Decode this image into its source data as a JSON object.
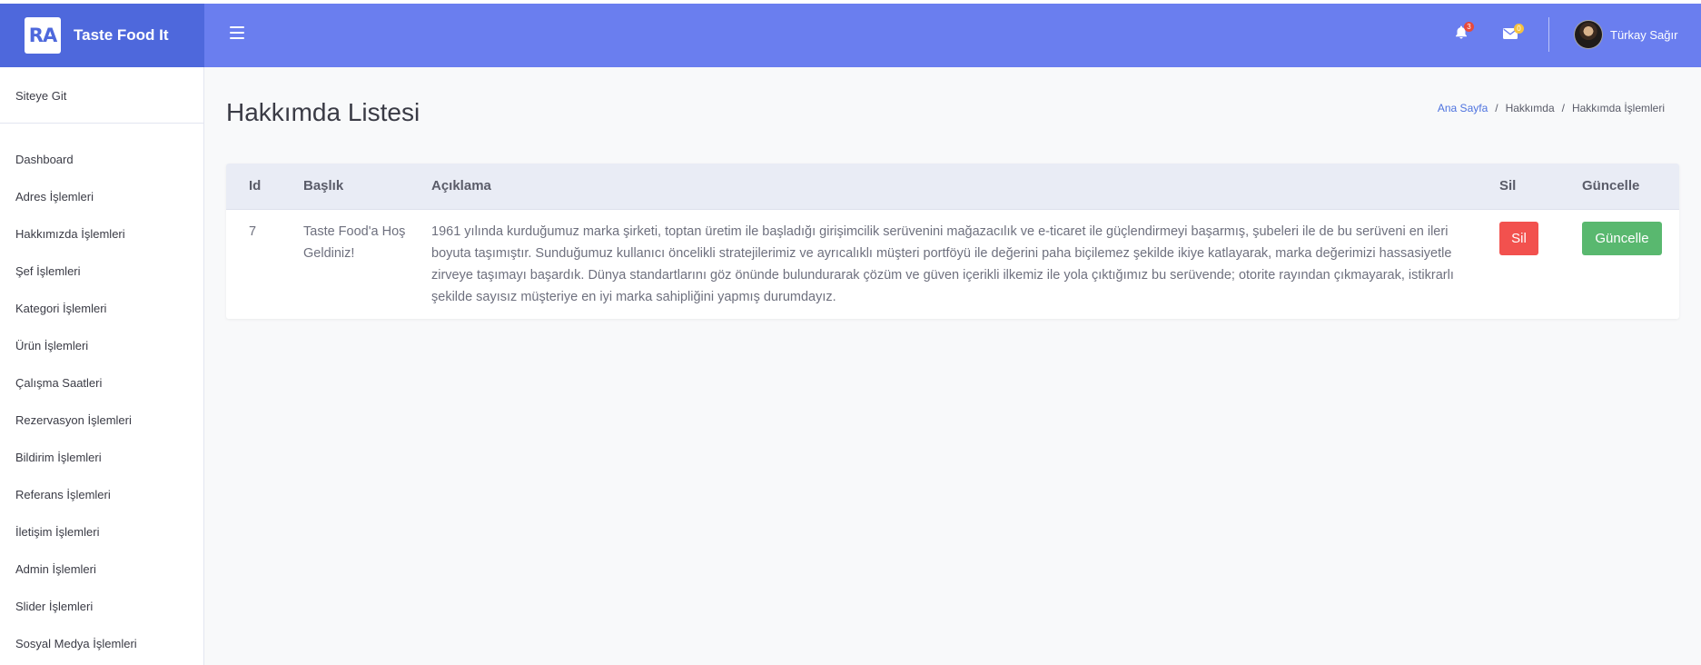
{
  "brand": {
    "logo_text": "RA",
    "name": "Taste Food It",
    "color": "#4e68dc"
  },
  "topbar": {
    "color": "#6a7eef",
    "notifications_count": "3",
    "messages_count": "0",
    "user_name": "Türkay Sağır"
  },
  "sidebar": {
    "site_link": "Siteye Git",
    "items": [
      {
        "label": "Dashboard"
      },
      {
        "label": "Adres İşlemleri"
      },
      {
        "label": "Hakkımızda İşlemleri"
      },
      {
        "label": "Şef İşlemleri"
      },
      {
        "label": "Kategori İşlemleri"
      },
      {
        "label": "Ürün İşlemleri"
      },
      {
        "label": "Çalışma Saatleri"
      },
      {
        "label": "Rezervasyon İşlemleri"
      },
      {
        "label": "Bildirim İşlemleri"
      },
      {
        "label": "Referans İşlemleri"
      },
      {
        "label": "İletişim İşlemleri"
      },
      {
        "label": "Admin İşlemleri"
      },
      {
        "label": "Slider İşlemleri"
      },
      {
        "label": "Sosyal Medya İşlemleri"
      }
    ]
  },
  "page": {
    "title": "Hakkımda Listesi",
    "breadcrumb": [
      "Ana Sayfa",
      "Hakkımda",
      "Hakkımda İşlemleri"
    ]
  },
  "table": {
    "headers": {
      "id": "Id",
      "title": "Başlık",
      "description": "Açıklama",
      "delete": "Sil",
      "update": "Güncelle"
    },
    "rows": [
      {
        "id": "7",
        "title": "Taste Food'a Hoş Geldiniz!",
        "description": "1961 yılında kurduğumuz marka şirketi, toptan üretim ile başladığı girişimcilik serüvenini mağazacılık ve e-ticaret ile güçlendirmeyi başarmış, şubeleri ile de bu serüveni en ileri boyuta taşımıştır. Sunduğumuz kullanıcı öncelikli stratejilerimiz ve ayrıcalıklı müşteri portföyü ile değerini paha biçilemez şekilde ikiye katlayarak, marka değerimizi hassasiyetle zirveye taşımayı başardık. Dünya standartlarını göz önünde bulundurarak çözüm ve güven içerikli ilkemiz ile yola çıktığımız bu serüvende; otorite rayından çıkmayarak, istikrarlı şekilde sayısız müşteriye en iyi marka sahipliğini yapmış durumdayız.",
        "delete_label": "Sil",
        "update_label": "Güncelle"
      }
    ]
  },
  "colors": {
    "delete": "#f2514e",
    "update": "#59b86f",
    "link": "#4e73df"
  }
}
